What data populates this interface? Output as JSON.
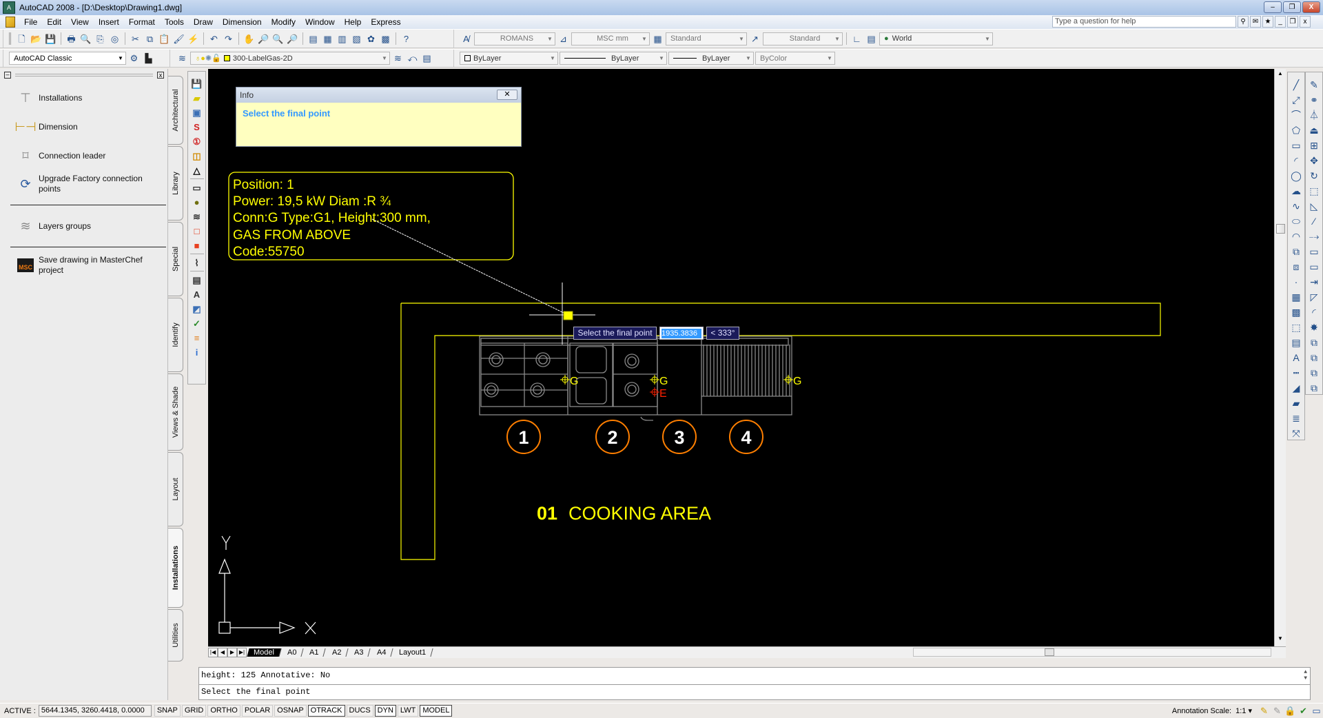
{
  "window": {
    "title": "AutoCAD 2008 - [D:\\Desktop\\Drawing1.dwg]",
    "minimize": "–",
    "restore": "❐",
    "close": "X"
  },
  "menu": [
    "File",
    "Edit",
    "View",
    "Insert",
    "Format",
    "Tools",
    "Draw",
    "Dimension",
    "Modify",
    "Window",
    "Help",
    "Express"
  ],
  "help": {
    "placeholder": "Type a question for help",
    "icons": [
      "search-icon",
      "communication-center-icon",
      "favorites-icon",
      "doc-minimize-icon",
      "doc-restore-icon",
      "doc-close-icon"
    ],
    "glyphs": [
      "⚲",
      "✉",
      "★",
      "_",
      "❐",
      "x"
    ]
  },
  "toolbar1": {
    "icons": [
      [
        "new-icon",
        "🗋"
      ],
      [
        "open-icon",
        "📂"
      ],
      [
        "save-icon",
        "💾"
      ],
      [
        "plot-icon",
        "🖶"
      ],
      [
        "plot-preview-icon",
        "🔍"
      ],
      [
        "publish-icon",
        "⎘"
      ],
      [
        "3d-dwf-icon",
        "◎"
      ],
      [
        "cut-icon",
        "✂"
      ],
      [
        "copy-icon",
        "⧉"
      ],
      [
        "paste-icon",
        "📋"
      ],
      [
        "match-properties-icon",
        "🖌"
      ],
      [
        "block-editor-icon",
        "⚡"
      ],
      [
        "undo-icon",
        "↶"
      ],
      [
        "redo-icon",
        "↷"
      ],
      [
        "pan-icon",
        "✋"
      ],
      [
        "zoom-realtime-icon",
        "🔎"
      ],
      [
        "zoom-window-icon",
        "🔍"
      ],
      [
        "zoom-previous-icon",
        "🔎"
      ],
      [
        "properties-icon",
        "▤"
      ],
      [
        "design-center-icon",
        "▦"
      ],
      [
        "tool-palettes-icon",
        "▥"
      ],
      [
        "sheet-set-icon",
        "▧"
      ],
      [
        "markup-icon",
        "✿"
      ],
      [
        "calculator-icon",
        "▩"
      ],
      [
        "help-icon",
        "?"
      ]
    ],
    "text_style": "ROMANS",
    "dim_style": "MSC mm",
    "table_style": "Standard",
    "mleader_style": "Standard",
    "ucs": "World",
    "style_icons": [
      "text-style-icon",
      "dim-style-icon",
      "table-style-icon",
      "mleader-style-icon",
      "ucs-icon",
      "ucs-named-icon",
      "globe-icon"
    ]
  },
  "toolbar2": {
    "workspace": "AutoCAD Classic",
    "layer": "300-LabelGas-2D",
    "color": "ByLayer",
    "linetype": "ByLayer",
    "lineweight": "ByLayer",
    "plotstyle": "ByColor"
  },
  "palette": {
    "items": [
      {
        "label": "Installations",
        "icon": "pipe-tee-icon"
      },
      {
        "label": "Dimension",
        "icon": "dimension-icon"
      },
      {
        "label": "Connection leader",
        "icon": "tag-icon"
      },
      {
        "label": "Upgrade Factory connection points",
        "icon": "upgrade-icon"
      },
      {
        "label": "Layers groups",
        "icon": "layers-icon"
      },
      {
        "label": "Save drawing in MasterChef project",
        "icon": "msc-save-icon",
        "badge": "MSC"
      }
    ],
    "tabs": [
      "Architectural",
      "Library",
      "Special",
      "Identify",
      "Views & Shade",
      "Layout",
      "Installations",
      "Utilities"
    ],
    "active_tab": "Installations"
  },
  "vtools": [
    [
      "save-icon",
      "💾",
      "#1a3f8a"
    ],
    [
      "block-icon",
      "▰",
      "#d8c800"
    ],
    [
      "computer-icon",
      "▣",
      "#3b6fb5"
    ],
    [
      "symbol-s-icon",
      "S",
      "#d02020"
    ],
    [
      "number-icon",
      "①",
      "#d02020"
    ],
    [
      "box-icon",
      "◫",
      "#d08a00"
    ],
    [
      "triangle-icon",
      "△",
      "#000"
    ],
    [
      "rectangle-icon",
      "▭",
      "#333"
    ],
    [
      "object-icon",
      "●",
      "#707010"
    ],
    [
      "layers-icon",
      "≋",
      "#333"
    ],
    [
      "square-icon",
      "□",
      "#e03010"
    ],
    [
      "cube-icon",
      "■",
      "#e84020"
    ],
    [
      "route-icon",
      "⌇",
      "#333"
    ],
    [
      "report-icon",
      "▤",
      "#333"
    ],
    [
      "text-size-icon",
      "A",
      "#333"
    ],
    [
      "flag-icon",
      "◩",
      "#3b6fb5"
    ],
    [
      "check-gear-icon",
      "✓",
      "#2a8a2a"
    ],
    [
      "bars-icon",
      "≡",
      "#e08020"
    ],
    [
      "info-icon",
      "i",
      "#2f6fd0"
    ]
  ],
  "rtools_draw": [
    [
      "line-icon",
      "╱"
    ],
    [
      "construction-line-icon",
      "⤢"
    ],
    [
      "polyline-icon",
      "⌒"
    ],
    [
      "polygon-icon",
      "⬠"
    ],
    [
      "rectangle-icon",
      "▭"
    ],
    [
      "arc-icon",
      "◜"
    ],
    [
      "circle-icon",
      "◯"
    ],
    [
      "revcloud-icon",
      "☁"
    ],
    [
      "spline-icon",
      "∿"
    ],
    [
      "ellipse-icon",
      "⬭"
    ],
    [
      "ellipse-arc-icon",
      "◠"
    ],
    [
      "insert-block-icon",
      "⧉"
    ],
    [
      "make-block-icon",
      "⧈"
    ],
    [
      "point-icon",
      "·"
    ],
    [
      "hatch-icon",
      "▦"
    ],
    [
      "gradient-icon",
      "▩"
    ],
    [
      "region-icon",
      "⬚"
    ],
    [
      "table-icon",
      "▤"
    ],
    [
      "mtext-icon",
      "A"
    ],
    [
      "dim-linear-icon",
      "┅"
    ],
    [
      "dim-aligned-icon",
      "◢"
    ],
    [
      "dim-continue-icon",
      "▰"
    ],
    [
      "qleader-icon",
      "≣"
    ],
    [
      "dim-edit-icon",
      "⤧"
    ]
  ],
  "rtools_modify": [
    [
      "erase-icon",
      "✎"
    ],
    [
      "copy-icon",
      "⚭"
    ],
    [
      "mirror-icon",
      "⏃"
    ],
    [
      "offset-icon",
      "⏏"
    ],
    [
      "array-icon",
      "⊞"
    ],
    [
      "move-icon",
      "✥"
    ],
    [
      "rotate-icon",
      "↻"
    ],
    [
      "scale-icon",
      "⬚"
    ],
    [
      "stretch-icon",
      "◺"
    ],
    [
      "trim-icon",
      "⁄"
    ],
    [
      "extend-icon",
      "⤍"
    ],
    [
      "break-icon",
      "▭"
    ],
    [
      "break-at-point-icon",
      "▭"
    ],
    [
      "join-icon",
      "⇥"
    ],
    [
      "chamfer-icon",
      "◸"
    ],
    [
      "fillet-icon",
      "◜"
    ],
    [
      "explode-icon",
      "✸"
    ],
    [
      "draworder-front-icon",
      "⧉"
    ],
    [
      "draworder-back-icon",
      "⧉"
    ],
    [
      "draworder-above-icon",
      "⧉"
    ],
    [
      "draworder-under-icon",
      "⧉"
    ]
  ],
  "drawing": {
    "info_title": "Info",
    "info_message": "Select the final point",
    "label_lines": [
      "Position: 1",
      "Power: 19,5 kW  Diam :R ¾",
      "Conn:G Type:G1,  Height:300 mm,",
      "GAS FROM ABOVE",
      "Code:55750"
    ],
    "positions": [
      "1",
      "2",
      "3",
      "4"
    ],
    "connection_labels": [
      "G",
      "G",
      "E",
      "G"
    ],
    "area_number": "01",
    "area_name": "COOKING AREA",
    "dyn_prompt": "Select the final point",
    "dyn_distance": "1935.3836",
    "dyn_angle": "< 333°",
    "ucs_x": "X",
    "ucs_y": "Y",
    "colors": {
      "counter": "#ffff00",
      "equipment": "#808080",
      "marker": "#ff7f00",
      "gas": "#ffff00",
      "electric": "#ff2000"
    }
  },
  "layout_tabs": [
    "Model",
    "A0",
    "A1",
    "A2",
    "A3",
    "A4",
    "Layout1"
  ],
  "active_layout": "Model",
  "command": {
    "history": "height:  125  Annotative:  No",
    "prompt": "Select the final point"
  },
  "status": {
    "label": "ACTIVE :",
    "coords": "5644.1345, 3260.4418, 0.0000",
    "buttons": [
      {
        "label": "SNAP",
        "on": false
      },
      {
        "label": "GRID",
        "on": false
      },
      {
        "label": "ORTHO",
        "on": false
      },
      {
        "label": "POLAR",
        "on": false
      },
      {
        "label": "OSNAP",
        "on": false
      },
      {
        "label": "OTRACK",
        "on": true
      },
      {
        "label": "DUCS",
        "on": false
      },
      {
        "label": "DYN",
        "on": true
      },
      {
        "label": "LWT",
        "on": false
      },
      {
        "label": "MODEL",
        "on": true
      }
    ],
    "annotation_scale_label": "Annotation Scale:",
    "annotation_scale": "1:1 ▾"
  }
}
